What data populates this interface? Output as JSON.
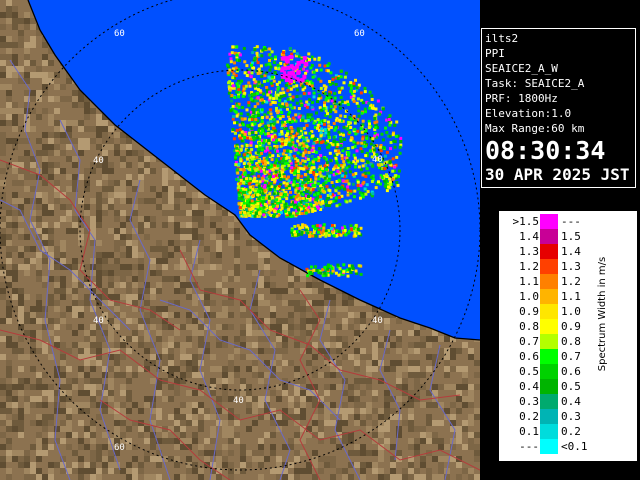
{
  "info": {
    "site": "ilts2",
    "product": "PPI",
    "scan": "SEAICE2_A_W",
    "task": "Task: SEAICE2_A",
    "prf": "PRF: 1800Hz",
    "elevation": "Elevation:1.0",
    "max_range": "Max Range:60 km",
    "time": "08:30:34",
    "date": "30 APR 2025 JST"
  },
  "range_labels": [
    "60",
    "60",
    "40",
    "40",
    "40",
    "40",
    "40",
    "60"
  ],
  "legend": {
    "title": "Spectrum Width in m/s",
    "rows": [
      {
        "lo": ">1.5",
        "hi": "---",
        "color": "#ff00ff"
      },
      {
        "lo": "1.4",
        "hi": "1.5",
        "color": "#c80096"
      },
      {
        "lo": "1.3",
        "hi": "1.4",
        "color": "#e60000"
      },
      {
        "lo": "1.2",
        "hi": "1.3",
        "color": "#ff4000"
      },
      {
        "lo": "1.1",
        "hi": "1.2",
        "color": "#ff8000"
      },
      {
        "lo": "1.0",
        "hi": "1.1",
        "color": "#ffb400"
      },
      {
        "lo": "0.9",
        "hi": "1.0",
        "color": "#ffe600"
      },
      {
        "lo": "0.8",
        "hi": "0.9",
        "color": "#ffff00"
      },
      {
        "lo": "0.7",
        "hi": "0.8",
        "color": "#b4ff00"
      },
      {
        "lo": "0.6",
        "hi": "0.7",
        "color": "#00ff00"
      },
      {
        "lo": "0.5",
        "hi": "0.6",
        "color": "#00d200"
      },
      {
        "lo": "0.4",
        "hi": "0.5",
        "color": "#00b400"
      },
      {
        "lo": "0.3",
        "hi": "0.4",
        "color": "#00aa6e"
      },
      {
        "lo": "0.2",
        "hi": "0.3",
        "color": "#00b4b4"
      },
      {
        "lo": "0.1",
        "hi": "0.2",
        "color": "#00dcdc"
      },
      {
        "lo": "---",
        "hi": "<0.1",
        "color": "#00ffff"
      }
    ]
  },
  "colors": {
    "sea": "#0050ff",
    "land": "#8c7250",
    "range_ring": "#000000",
    "river": "#6a6ac8",
    "boundary": "#b43c3c",
    "coastline": "#000000"
  }
}
